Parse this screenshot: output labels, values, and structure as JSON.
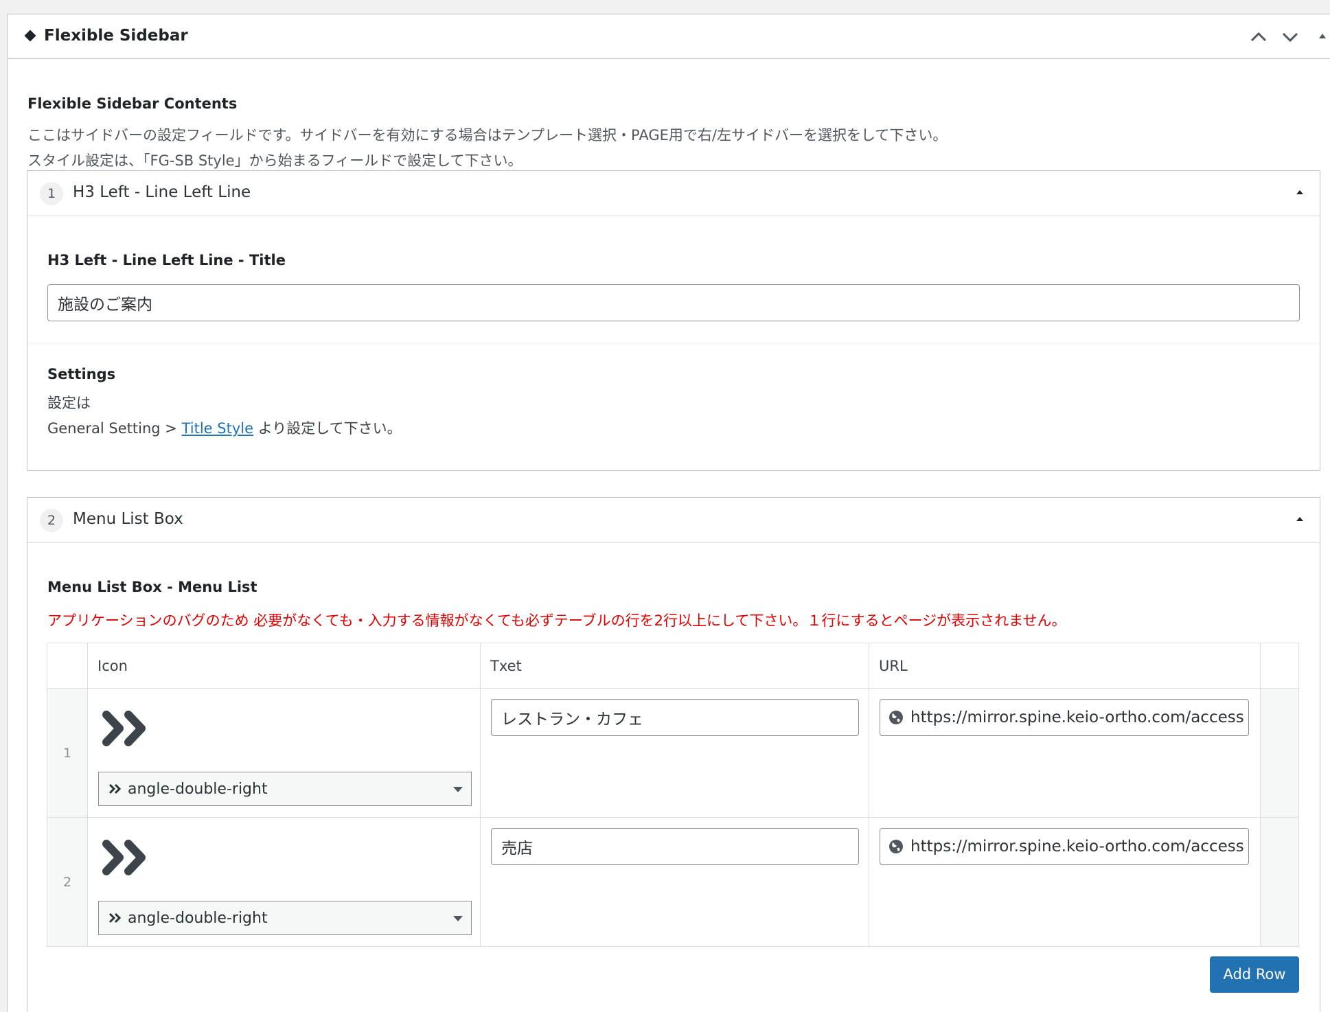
{
  "metabox": {
    "title": "Flexible Sidebar",
    "description_title": "Flexible Sidebar Contents",
    "description_lines": [
      "ここはサイドバーの設定フィールドです。サイドバーを有効にする場合はテンプレート選択・PAGE用で右/左サイドバーを選択をして下さい。",
      "スタイル設定は、「FG-SB Style」から始まるフィールドで設定して下さい。"
    ]
  },
  "layout1": {
    "order": "1",
    "name": "H3 Left - Line Left Line",
    "title_label": "H3 Left - Line Left Line - Title",
    "title_value": "施設のご案内",
    "settings_label": "Settings",
    "settings_line1": "設定は",
    "settings_prefix": "General Setting > ",
    "settings_link": "Title Style",
    "settings_suffix": " より設定して下さい。"
  },
  "layout2": {
    "order": "2",
    "name": "Menu List Box",
    "field_label": "Menu List Box - Menu List",
    "warning": "アプリケーションのバグのため 必要がなくても・入力する情報がなくても必ずテーブルの行を2行以上にして下さい。１行にするとページが表示されません。",
    "columns": [
      "Icon",
      "Txet",
      "URL"
    ],
    "rows": [
      {
        "num": "1",
        "icon": "angle-double-right",
        "text": "レストラン・カフェ",
        "url": "https://mirror.spine.keio-ortho.com/access"
      },
      {
        "num": "2",
        "icon": "angle-double-right",
        "text": "売店",
        "url": "https://mirror.spine.keio-ortho.com/access"
      }
    ],
    "add_row": "Add Row"
  }
}
